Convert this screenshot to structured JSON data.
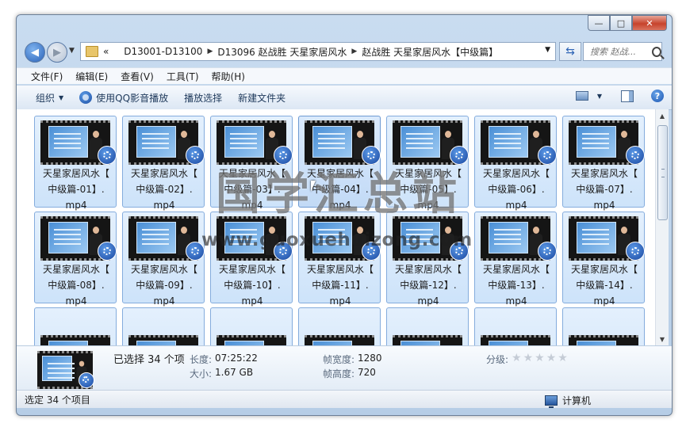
{
  "window": {
    "controls": {
      "minimize": "—",
      "maximize": "□",
      "close": "✕"
    }
  },
  "address": {
    "overflow": "«",
    "breadcrumbs": [
      "D13001-D13100",
      "D13096 赵战胜 天星家居风水",
      "赵战胜 天星家居风水【中级篇】"
    ],
    "search_placeholder": "搜索 赵战..."
  },
  "menu": {
    "items": [
      "文件(F)",
      "编辑(E)",
      "查看(V)",
      "工具(T)",
      "帮助(H)"
    ]
  },
  "toolbar": {
    "organize": "组织",
    "play_qq": "使用QQ影音播放",
    "play_selected": "播放选择",
    "new_folder": "新建文件夹"
  },
  "files": [
    {
      "line1": "天星家居风水【",
      "line2": "中级篇-01】.",
      "line3": "mp4"
    },
    {
      "line1": "天星家居风水【",
      "line2": "中级篇-02】.",
      "line3": "mp4"
    },
    {
      "line1": "天星家居风水【",
      "line2": "中级篇-03】.",
      "line3": "mp4"
    },
    {
      "line1": "天星家居风水【",
      "line2": "中级篇-04】.",
      "line3": "mp4"
    },
    {
      "line1": "天星家居风水【",
      "line2": "中级篇-05】.",
      "line3": "mp4"
    },
    {
      "line1": "天星家居风水【",
      "line2": "中级篇-06】.",
      "line3": "mp4"
    },
    {
      "line1": "天星家居风水【",
      "line2": "中级篇-07】.",
      "line3": "mp4"
    },
    {
      "line1": "天星家居风水【",
      "line2": "中级篇-08】.",
      "line3": "mp4"
    },
    {
      "line1": "天星家居风水【",
      "line2": "中级篇-09】.",
      "line3": "mp4"
    },
    {
      "line1": "天星家居风水【",
      "line2": "中级篇-10】.",
      "line3": "mp4"
    },
    {
      "line1": "天星家居风水【",
      "line2": "中级篇-11】.",
      "line3": "mp4"
    },
    {
      "line1": "天星家居风水【",
      "line2": "中级篇-12】.",
      "line3": "mp4"
    },
    {
      "line1": "天星家居风水【",
      "line2": "中级篇-13】.",
      "line3": "mp4"
    },
    {
      "line1": "天星家居风水【",
      "line2": "中级篇-14】.",
      "line3": "mp4"
    }
  ],
  "details": {
    "selected_count": "已选择 34 个项",
    "length_label": "长度:",
    "length_value": "07:25:22",
    "size_label": "大小:",
    "size_value": "1.67 GB",
    "frame_width_label": "帧宽度:",
    "frame_width_value": "1280",
    "frame_height_label": "帧高度:",
    "frame_height_value": "720",
    "rating_label": "分级:",
    "rating_stars": 0
  },
  "status": {
    "left": "选定 34 个项目",
    "right": "计算机"
  },
  "watermark": {
    "cn": "国学汇总站",
    "url": "www.guoxuehuizong.com"
  }
}
